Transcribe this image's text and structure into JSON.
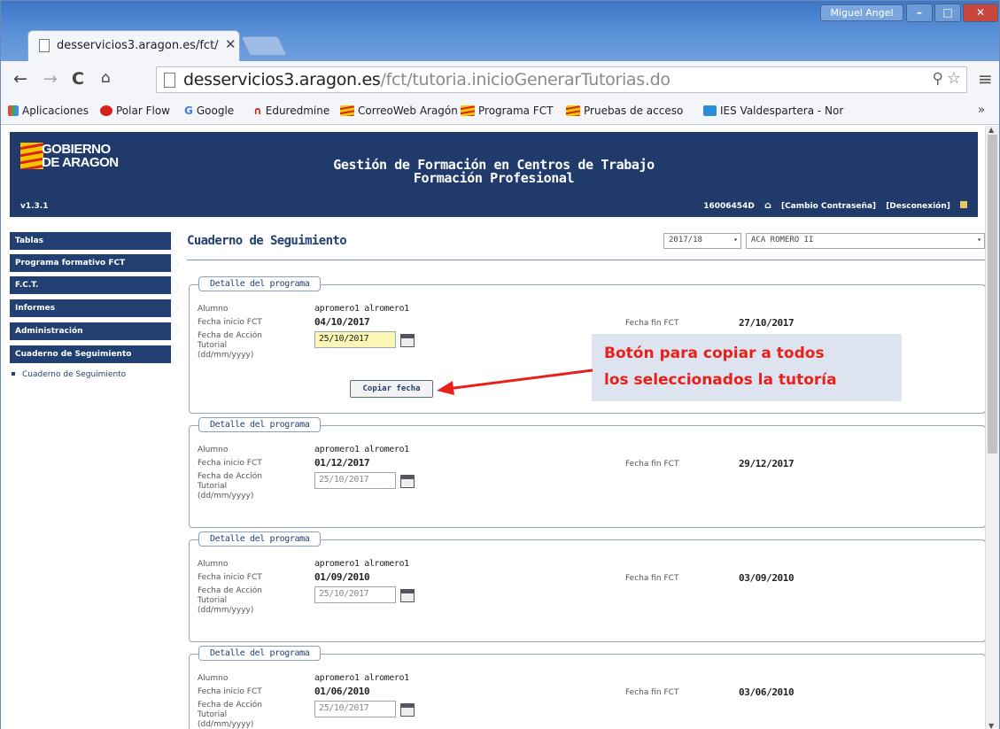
{
  "browser": {
    "tab_title": "desservicios3.aragon.es/fct/",
    "user_name": "Miguel Angel",
    "url_host": "desservicios3.aragon.es",
    "url_path": "/fct/tutoria.inicioGenerarTutorias.do",
    "bookmarks": [
      "Aplicaciones",
      "Polar Flow",
      "Google",
      "Eduredmine",
      "CorreoWeb Aragón",
      "Programa FCT",
      "Pruebas de acceso",
      "IES Valdespartera - Nor"
    ],
    "bookmark_more": "»"
  },
  "header": {
    "logo_line1": "GOBIERNO",
    "logo_line2": "DE ARAGON",
    "title": "Gestión de Formación en Centros de Trabajo",
    "subtitle": "Formación Profesional",
    "version": "v1.3.1",
    "user_id": "16006454D",
    "change_password": "[Cambio Contraseña]",
    "logout": "[Desconexión]"
  },
  "sidebar": {
    "items": [
      "Tablas",
      "Programa formativo FCT",
      "F.C.T.",
      "Informes",
      "Administración",
      "Cuaderno de Seguimiento"
    ],
    "sub_item": "Cuaderno de Seguimiento"
  },
  "main": {
    "title": "Cuaderno de Seguimiento",
    "year_select": "2017/18",
    "center_select": "ACA ROMERO II"
  },
  "labels": {
    "legend": "Detalle del programa",
    "alumno": "Alumno",
    "fecha_inicio": "Fecha inicio FCT",
    "fecha_fin": "Fecha fin FCT",
    "fecha_accion_1": "Fecha de Acción",
    "fecha_accion_2": "Tutorial",
    "fecha_accion_3": "(dd/mm/yyyy)",
    "copy_button": "Copiar fecha"
  },
  "programs": [
    {
      "alumno": "apromero1 alromero1",
      "inicio": "04/10/2017",
      "fin": "27/10/2017",
      "fecha_accion": "25/10/2017"
    },
    {
      "alumno": "apromero1 alromero1",
      "inicio": "01/12/2017",
      "fin": "29/12/2017",
      "fecha_accion": "25/10/2017"
    },
    {
      "alumno": "apromero1 alromero1",
      "inicio": "01/09/2010",
      "fin": "03/09/2010",
      "fecha_accion": "25/10/2017"
    },
    {
      "alumno": "apromero1 alromero1",
      "inicio": "01/06/2010",
      "fin": "03/06/2010",
      "fecha_accion": "25/10/2017"
    }
  ],
  "callout": {
    "line1": "Botón para copiar a todos",
    "line2": "los seleccionados la tutoría"
  },
  "colors": {
    "banner": "#1f3a6b",
    "callout_text": "#e8201b",
    "callout_bg": "#dde4ef",
    "active_date_bg": "#fdf7b5"
  }
}
